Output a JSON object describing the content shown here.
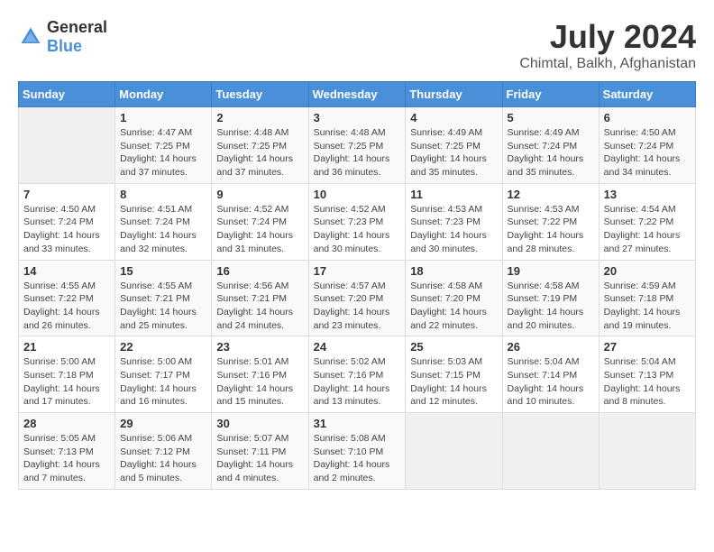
{
  "header": {
    "logo_general": "General",
    "logo_blue": "Blue",
    "title": "July 2024",
    "subtitle": "Chimtal, Balkh, Afghanistan"
  },
  "calendar": {
    "days_of_week": [
      "Sunday",
      "Monday",
      "Tuesday",
      "Wednesday",
      "Thursday",
      "Friday",
      "Saturday"
    ],
    "weeks": [
      [
        {
          "day": "",
          "sunrise": "",
          "sunset": "",
          "daylight": ""
        },
        {
          "day": "1",
          "sunrise": "Sunrise: 4:47 AM",
          "sunset": "Sunset: 7:25 PM",
          "daylight": "Daylight: 14 hours and 37 minutes."
        },
        {
          "day": "2",
          "sunrise": "Sunrise: 4:48 AM",
          "sunset": "Sunset: 7:25 PM",
          "daylight": "Daylight: 14 hours and 37 minutes."
        },
        {
          "day": "3",
          "sunrise": "Sunrise: 4:48 AM",
          "sunset": "Sunset: 7:25 PM",
          "daylight": "Daylight: 14 hours and 36 minutes."
        },
        {
          "day": "4",
          "sunrise": "Sunrise: 4:49 AM",
          "sunset": "Sunset: 7:25 PM",
          "daylight": "Daylight: 14 hours and 35 minutes."
        },
        {
          "day": "5",
          "sunrise": "Sunrise: 4:49 AM",
          "sunset": "Sunset: 7:24 PM",
          "daylight": "Daylight: 14 hours and 35 minutes."
        },
        {
          "day": "6",
          "sunrise": "Sunrise: 4:50 AM",
          "sunset": "Sunset: 7:24 PM",
          "daylight": "Daylight: 14 hours and 34 minutes."
        }
      ],
      [
        {
          "day": "7",
          "sunrise": "Sunrise: 4:50 AM",
          "sunset": "Sunset: 7:24 PM",
          "daylight": "Daylight: 14 hours and 33 minutes."
        },
        {
          "day": "8",
          "sunrise": "Sunrise: 4:51 AM",
          "sunset": "Sunset: 7:24 PM",
          "daylight": "Daylight: 14 hours and 32 minutes."
        },
        {
          "day": "9",
          "sunrise": "Sunrise: 4:52 AM",
          "sunset": "Sunset: 7:24 PM",
          "daylight": "Daylight: 14 hours and 31 minutes."
        },
        {
          "day": "10",
          "sunrise": "Sunrise: 4:52 AM",
          "sunset": "Sunset: 7:23 PM",
          "daylight": "Daylight: 14 hours and 30 minutes."
        },
        {
          "day": "11",
          "sunrise": "Sunrise: 4:53 AM",
          "sunset": "Sunset: 7:23 PM",
          "daylight": "Daylight: 14 hours and 30 minutes."
        },
        {
          "day": "12",
          "sunrise": "Sunrise: 4:53 AM",
          "sunset": "Sunset: 7:22 PM",
          "daylight": "Daylight: 14 hours and 28 minutes."
        },
        {
          "day": "13",
          "sunrise": "Sunrise: 4:54 AM",
          "sunset": "Sunset: 7:22 PM",
          "daylight": "Daylight: 14 hours and 27 minutes."
        }
      ],
      [
        {
          "day": "14",
          "sunrise": "Sunrise: 4:55 AM",
          "sunset": "Sunset: 7:22 PM",
          "daylight": "Daylight: 14 hours and 26 minutes."
        },
        {
          "day": "15",
          "sunrise": "Sunrise: 4:55 AM",
          "sunset": "Sunset: 7:21 PM",
          "daylight": "Daylight: 14 hours and 25 minutes."
        },
        {
          "day": "16",
          "sunrise": "Sunrise: 4:56 AM",
          "sunset": "Sunset: 7:21 PM",
          "daylight": "Daylight: 14 hours and 24 minutes."
        },
        {
          "day": "17",
          "sunrise": "Sunrise: 4:57 AM",
          "sunset": "Sunset: 7:20 PM",
          "daylight": "Daylight: 14 hours and 23 minutes."
        },
        {
          "day": "18",
          "sunrise": "Sunrise: 4:58 AM",
          "sunset": "Sunset: 7:20 PM",
          "daylight": "Daylight: 14 hours and 22 minutes."
        },
        {
          "day": "19",
          "sunrise": "Sunrise: 4:58 AM",
          "sunset": "Sunset: 7:19 PM",
          "daylight": "Daylight: 14 hours and 20 minutes."
        },
        {
          "day": "20",
          "sunrise": "Sunrise: 4:59 AM",
          "sunset": "Sunset: 7:18 PM",
          "daylight": "Daylight: 14 hours and 19 minutes."
        }
      ],
      [
        {
          "day": "21",
          "sunrise": "Sunrise: 5:00 AM",
          "sunset": "Sunset: 7:18 PM",
          "daylight": "Daylight: 14 hours and 17 minutes."
        },
        {
          "day": "22",
          "sunrise": "Sunrise: 5:00 AM",
          "sunset": "Sunset: 7:17 PM",
          "daylight": "Daylight: 14 hours and 16 minutes."
        },
        {
          "day": "23",
          "sunrise": "Sunrise: 5:01 AM",
          "sunset": "Sunset: 7:16 PM",
          "daylight": "Daylight: 14 hours and 15 minutes."
        },
        {
          "day": "24",
          "sunrise": "Sunrise: 5:02 AM",
          "sunset": "Sunset: 7:16 PM",
          "daylight": "Daylight: 14 hours and 13 minutes."
        },
        {
          "day": "25",
          "sunrise": "Sunrise: 5:03 AM",
          "sunset": "Sunset: 7:15 PM",
          "daylight": "Daylight: 14 hours and 12 minutes."
        },
        {
          "day": "26",
          "sunrise": "Sunrise: 5:04 AM",
          "sunset": "Sunset: 7:14 PM",
          "daylight": "Daylight: 14 hours and 10 minutes."
        },
        {
          "day": "27",
          "sunrise": "Sunrise: 5:04 AM",
          "sunset": "Sunset: 7:13 PM",
          "daylight": "Daylight: 14 hours and 8 minutes."
        }
      ],
      [
        {
          "day": "28",
          "sunrise": "Sunrise: 5:05 AM",
          "sunset": "Sunset: 7:13 PM",
          "daylight": "Daylight: 14 hours and 7 minutes."
        },
        {
          "day": "29",
          "sunrise": "Sunrise: 5:06 AM",
          "sunset": "Sunset: 7:12 PM",
          "daylight": "Daylight: 14 hours and 5 minutes."
        },
        {
          "day": "30",
          "sunrise": "Sunrise: 5:07 AM",
          "sunset": "Sunset: 7:11 PM",
          "daylight": "Daylight: 14 hours and 4 minutes."
        },
        {
          "day": "31",
          "sunrise": "Sunrise: 5:08 AM",
          "sunset": "Sunset: 7:10 PM",
          "daylight": "Daylight: 14 hours and 2 minutes."
        },
        {
          "day": "",
          "sunrise": "",
          "sunset": "",
          "daylight": ""
        },
        {
          "day": "",
          "sunrise": "",
          "sunset": "",
          "daylight": ""
        },
        {
          "day": "",
          "sunrise": "",
          "sunset": "",
          "daylight": ""
        }
      ]
    ]
  }
}
